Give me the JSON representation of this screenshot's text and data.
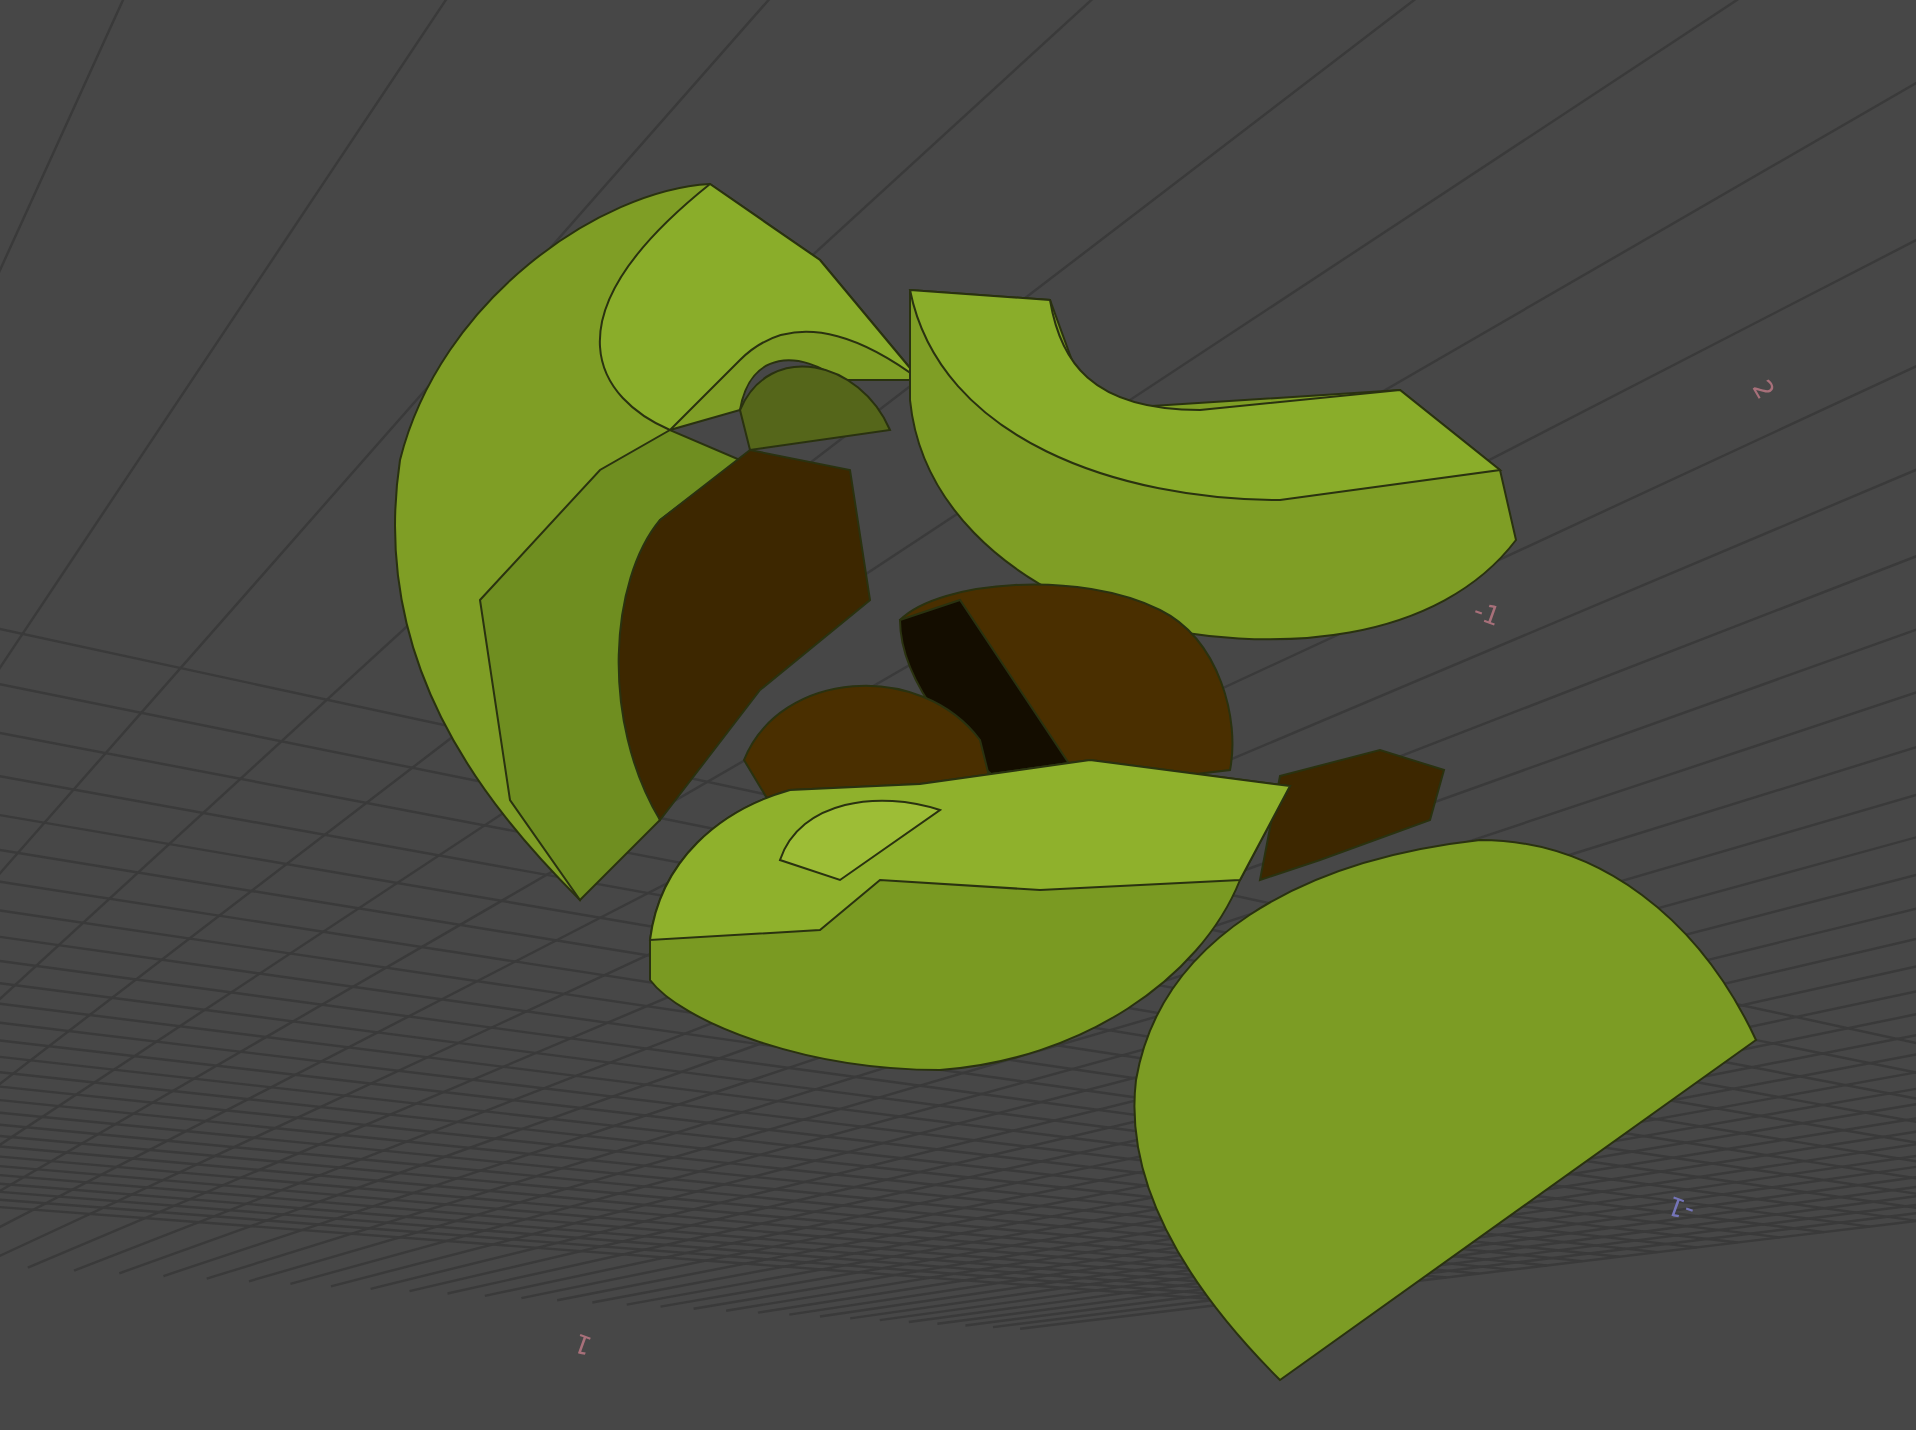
{
  "viewport": {
    "grid_labels": [
      {
        "text": "2",
        "color": "#a8707a"
      },
      {
        "text": "-1",
        "color": "#a8707a"
      },
      {
        "text": "-1",
        "color": "#7474b8"
      },
      {
        "text": "1",
        "color": "#a8707a"
      }
    ]
  }
}
